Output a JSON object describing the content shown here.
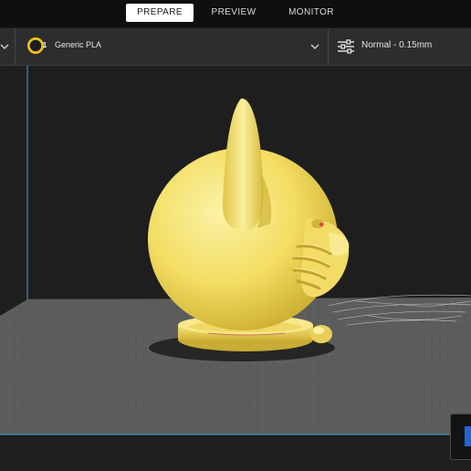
{
  "stages": {
    "prepare": "PREPARE",
    "preview": "PREVIEW",
    "monitor": "MONITOR",
    "active": "prepare"
  },
  "material": {
    "extruder_number": "1",
    "name": "Generic PLA",
    "badge_color": "#f3c518"
  },
  "print_profile": {
    "label": "Normal - 0.15mm"
  },
  "colors": {
    "model": "#f5e26e",
    "build_plate": "#5c5c5c",
    "build_volume_edge": "#3aa7d9",
    "active_tab": "#ffffff",
    "accent_button": "#1f63d7"
  }
}
